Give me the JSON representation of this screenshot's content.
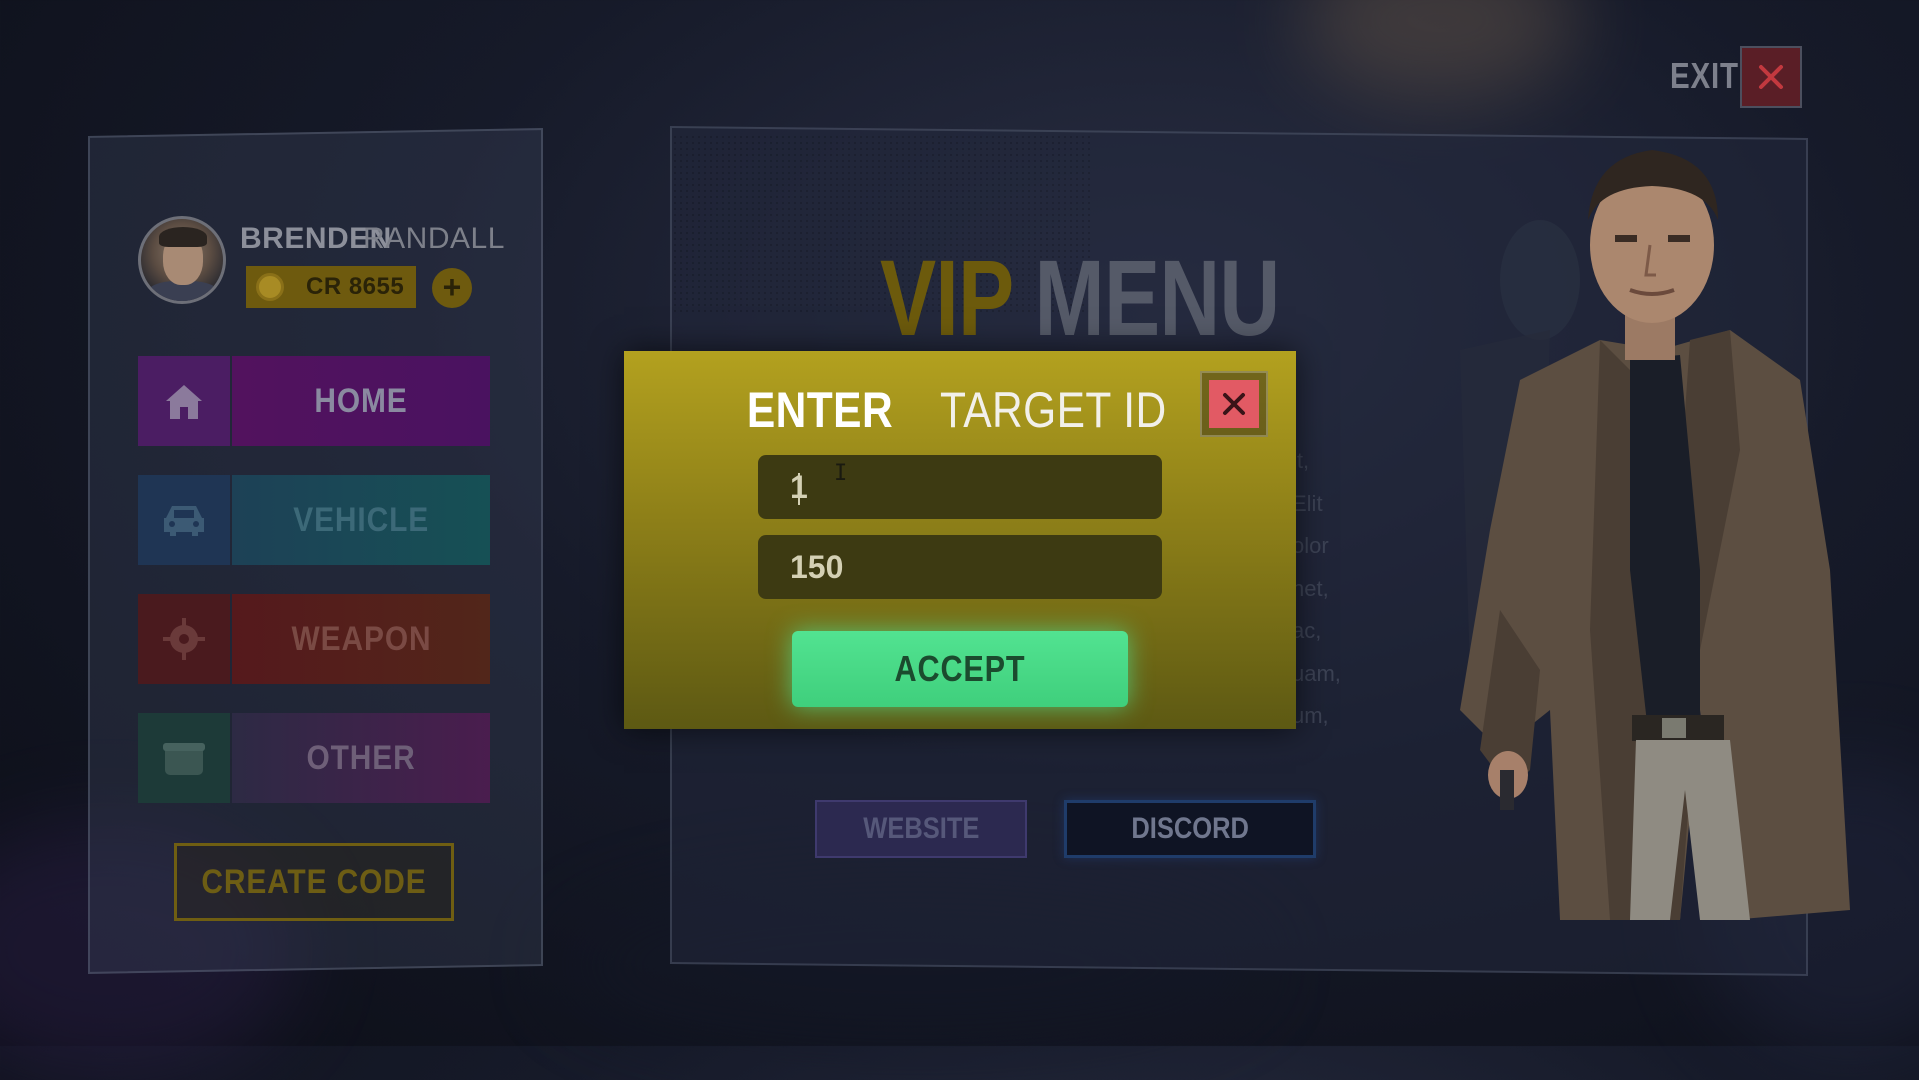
{
  "exit": {
    "label": "EXIT"
  },
  "user": {
    "first_name": "BRENDEN",
    "last_name": "RANDALL",
    "credits": "CR 8655",
    "add_credits": "+"
  },
  "nav": [
    {
      "label": "HOME",
      "icon": "home-icon"
    },
    {
      "label": "VEHICLE",
      "icon": "car-icon"
    },
    {
      "label": "WEAPON",
      "icon": "crosshair-icon"
    },
    {
      "label": "OTHER",
      "icon": "box-icon"
    }
  ],
  "create_code": {
    "label": "CREATE CODE"
  },
  "main": {
    "title_part1": "VIP",
    "title_part2": "MENU",
    "description_fragments": "it,\nElit\nolor\nnet,\nac,\nuam,\num,",
    "website_label": "WEBSITE",
    "discord_label": "DISCORD"
  },
  "modal": {
    "title_bold": "ENTER",
    "title_light": "TARGET ID",
    "target_id_value": "1",
    "amount_value": "150",
    "accept_label": "ACCEPT"
  },
  "colors": {
    "accent_gold": "#b3a11f",
    "accept_green": "#52e391",
    "close_red": "#e25a64",
    "home_purple": "#52125e",
    "vehicle_teal": "#165055",
    "weapon_red": "#55191c"
  }
}
